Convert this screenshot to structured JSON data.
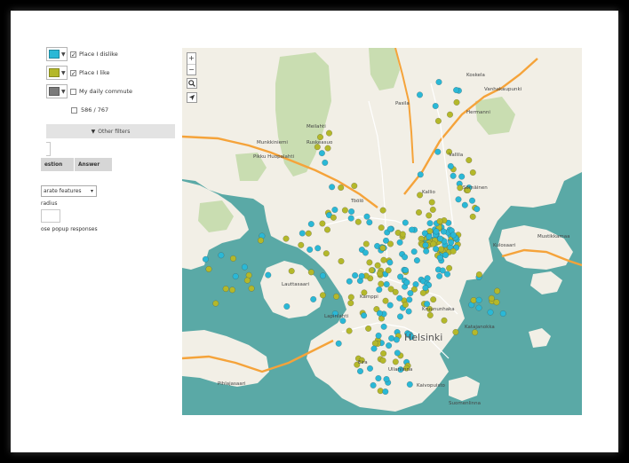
{
  "legend": {
    "items": [
      {
        "label": "Place I dislike",
        "color": "#2ab8d6",
        "checked": true
      },
      {
        "label": "Place I like",
        "color": "#b4b82a",
        "checked": true
      },
      {
        "label": "My daily commute",
        "color": "#7a7a7a",
        "checked": false
      }
    ],
    "count_text": "586 / 767"
  },
  "filters": {
    "label": "Other filters",
    "icon": "filter-icon"
  },
  "table": {
    "headers": [
      "estion",
      "Answer"
    ]
  },
  "display": {
    "select_value": "arate features",
    "radius_label": "radius",
    "popup_label": "ose popup responses"
  },
  "map": {
    "zoom_in": "+",
    "zoom_out": "−",
    "city_label": "Helsinki",
    "water_color": "#5aa9a6",
    "land_color": "#f2efe6",
    "park_color": "#c9ddb1",
    "road_color": "#f5a33a",
    "marker_colors": {
      "dislike": "#2ab8d6",
      "like": "#b4b82a"
    },
    "labels": [
      "Munkkiniemi",
      "Pikku Huopalahti",
      "Meilahti",
      "Ruskeasuo",
      "Lauttasaari",
      "Kallio",
      "Vallila",
      "Sörnäinen",
      "Kulosaari",
      "Kruununhaka",
      "Kamppi",
      "Katajanokka",
      "Eira",
      "Ullanlinna",
      "Hermanni",
      "Koskela",
      "Pasila",
      "Vanhakaupunki",
      "Mustikkamaa",
      "Pihlajasaari",
      "Suomenlinna",
      "Kaivopuisto",
      "Lapinlahti",
      "Töölö"
    ]
  }
}
